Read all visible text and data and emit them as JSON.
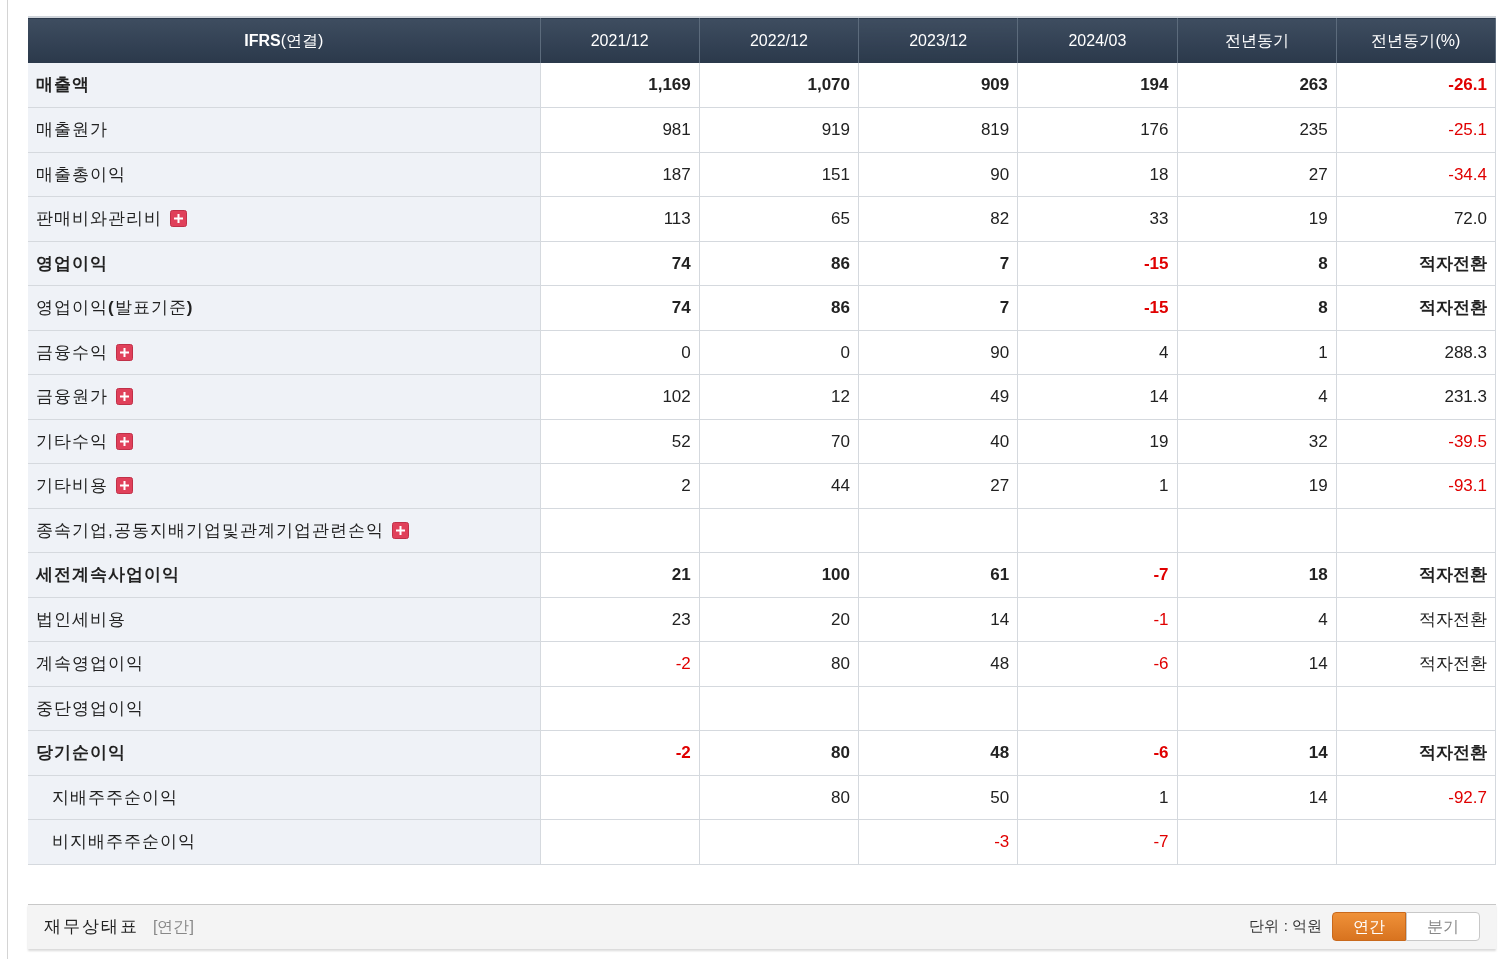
{
  "table": {
    "label_header": "**IFRS**(연결)",
    "columns": [
      "2021/12",
      "2022/12",
      "2023/12",
      "2024/03",
      "전년동기",
      "전년동기(%)"
    ],
    "rows": [
      {
        "label": "매출액",
        "bold": true,
        "child": false,
        "expandable": false,
        "cells": [
          {
            "v": "1,169",
            "negative": false
          },
          {
            "v": "1,070",
            "negative": false
          },
          {
            "v": "909",
            "negative": false
          },
          {
            "v": "194",
            "negative": false
          },
          {
            "v": "263",
            "negative": false
          },
          {
            "v": "-26.1",
            "negative": true
          }
        ]
      },
      {
        "label": "매출원가",
        "bold": false,
        "child": false,
        "expandable": false,
        "cells": [
          {
            "v": "981",
            "negative": false
          },
          {
            "v": "919",
            "negative": false
          },
          {
            "v": "819",
            "negative": false
          },
          {
            "v": "176",
            "negative": false
          },
          {
            "v": "235",
            "negative": false
          },
          {
            "v": "-25.1",
            "negative": true
          }
        ]
      },
      {
        "label": "매출총이익",
        "bold": false,
        "child": false,
        "expandable": false,
        "cells": [
          {
            "v": "187",
            "negative": false
          },
          {
            "v": "151",
            "negative": false
          },
          {
            "v": "90",
            "negative": false
          },
          {
            "v": "18",
            "negative": false
          },
          {
            "v": "27",
            "negative": false
          },
          {
            "v": "-34.4",
            "negative": true
          }
        ]
      },
      {
        "label": "판매비와관리비",
        "bold": false,
        "child": false,
        "expandable": true,
        "cells": [
          {
            "v": "113",
            "negative": false
          },
          {
            "v": "65",
            "negative": false
          },
          {
            "v": "82",
            "negative": false
          },
          {
            "v": "33",
            "negative": false
          },
          {
            "v": "19",
            "negative": false
          },
          {
            "v": "72.0",
            "negative": false
          }
        ]
      },
      {
        "label": "영업이익",
        "bold": true,
        "child": false,
        "expandable": false,
        "cells": [
          {
            "v": "74",
            "negative": false
          },
          {
            "v": "86",
            "negative": false
          },
          {
            "v": "7",
            "negative": false
          },
          {
            "v": "-15",
            "negative": true
          },
          {
            "v": "8",
            "negative": false
          },
          {
            "v": "적자전환",
            "negative": false
          }
        ]
      },
      {
        "label": "영업이익**(**발표기준**)**",
        "bold": false,
        "child": false,
        "expandable": false,
        "cells": [
          {
            "v": "74",
            "negative": false
          },
          {
            "v": "86",
            "negative": false
          },
          {
            "v": "7",
            "negative": false
          },
          {
            "v": "-15",
            "negative": true
          },
          {
            "v": "8",
            "negative": false
          },
          {
            "v": "적자전환",
            "negative": false
          }
        ],
        "bold_values": true
      },
      {
        "label": "금융수익",
        "bold": false,
        "child": false,
        "expandable": true,
        "cells": [
          {
            "v": "0",
            "negative": false
          },
          {
            "v": "0",
            "negative": false
          },
          {
            "v": "90",
            "negative": false
          },
          {
            "v": "4",
            "negative": false
          },
          {
            "v": "1",
            "negative": false
          },
          {
            "v": "288.3",
            "negative": false
          }
        ]
      },
      {
        "label": "금융원가",
        "bold": false,
        "child": false,
        "expandable": true,
        "cells": [
          {
            "v": "102",
            "negative": false
          },
          {
            "v": "12",
            "negative": false
          },
          {
            "v": "49",
            "negative": false
          },
          {
            "v": "14",
            "negative": false
          },
          {
            "v": "4",
            "negative": false
          },
          {
            "v": "231.3",
            "negative": false
          }
        ]
      },
      {
        "label": "기타수익",
        "bold": false,
        "child": false,
        "expandable": true,
        "cells": [
          {
            "v": "52",
            "negative": false
          },
          {
            "v": "70",
            "negative": false
          },
          {
            "v": "40",
            "negative": false
          },
          {
            "v": "19",
            "negative": false
          },
          {
            "v": "32",
            "negative": false
          },
          {
            "v": "-39.5",
            "negative": true
          }
        ]
      },
      {
        "label": "기타비용",
        "bold": false,
        "child": false,
        "expandable": true,
        "cells": [
          {
            "v": "2",
            "negative": false
          },
          {
            "v": "44",
            "negative": false
          },
          {
            "v": "27",
            "negative": false
          },
          {
            "v": "1",
            "negative": false
          },
          {
            "v": "19",
            "negative": false
          },
          {
            "v": "-93.1",
            "negative": true
          }
        ]
      },
      {
        "label": "종속기업,공동지배기업및관계기업관련손익",
        "bold": false,
        "child": false,
        "expandable": true,
        "cells": []
      },
      {
        "label": "세전계속사업이익",
        "bold": true,
        "child": false,
        "expandable": false,
        "cells": [
          {
            "v": "21",
            "negative": false
          },
          {
            "v": "100",
            "negative": false
          },
          {
            "v": "61",
            "negative": false
          },
          {
            "v": "-7",
            "negative": true
          },
          {
            "v": "18",
            "negative": false
          },
          {
            "v": "적자전환",
            "negative": false
          }
        ]
      },
      {
        "label": "법인세비용",
        "bold": false,
        "child": false,
        "expandable": false,
        "cells": [
          {
            "v": "23",
            "negative": false
          },
          {
            "v": "20",
            "negative": false
          },
          {
            "v": "14",
            "negative": false
          },
          {
            "v": "-1",
            "negative": true
          },
          {
            "v": "4",
            "negative": false
          },
          {
            "v": "적자전환",
            "negative": false
          }
        ]
      },
      {
        "label": "계속영업이익",
        "bold": false,
        "child": false,
        "expandable": false,
        "cells": [
          {
            "v": "-2",
            "negative": true
          },
          {
            "v": "80",
            "negative": false
          },
          {
            "v": "48",
            "negative": false
          },
          {
            "v": "-6",
            "negative": true
          },
          {
            "v": "14",
            "negative": false
          },
          {
            "v": "적자전환",
            "negative": false
          }
        ]
      },
      {
        "label": "중단영업이익",
        "bold": false,
        "child": false,
        "expandable": false,
        "cells": []
      },
      {
        "label": "당기순이익",
        "bold": true,
        "child": false,
        "expandable": false,
        "cells": [
          {
            "v": "-2",
            "negative": true
          },
          {
            "v": "80",
            "negative": false
          },
          {
            "v": "48",
            "negative": false
          },
          {
            "v": "-6",
            "negative": true
          },
          {
            "v": "14",
            "negative": false
          },
          {
            "v": "적자전환",
            "negative": false
          }
        ]
      },
      {
        "label": "지배주주순이익",
        "bold": false,
        "child": true,
        "expandable": false,
        "cells": [
          null,
          {
            "v": "80",
            "negative": false
          },
          {
            "v": "50",
            "negative": false
          },
          {
            "v": "1",
            "negative": false
          },
          {
            "v": "14",
            "negative": false
          },
          {
            "v": "-92.7",
            "negative": true
          }
        ]
      },
      {
        "label": "비지배주주순이익",
        "bold": false,
        "child": true,
        "expandable": false,
        "cells": [
          null,
          null,
          {
            "v": "-3",
            "negative": true
          },
          {
            "v": "-7",
            "negative": true
          },
          null,
          null
        ]
      }
    ]
  },
  "footer": {
    "title": "재무상태표",
    "period": "[연간]",
    "unit": "단위 : 억원",
    "toggles": [
      {
        "label": "연간",
        "selected": true
      },
      {
        "label": "분기",
        "selected": false
      }
    ]
  }
}
